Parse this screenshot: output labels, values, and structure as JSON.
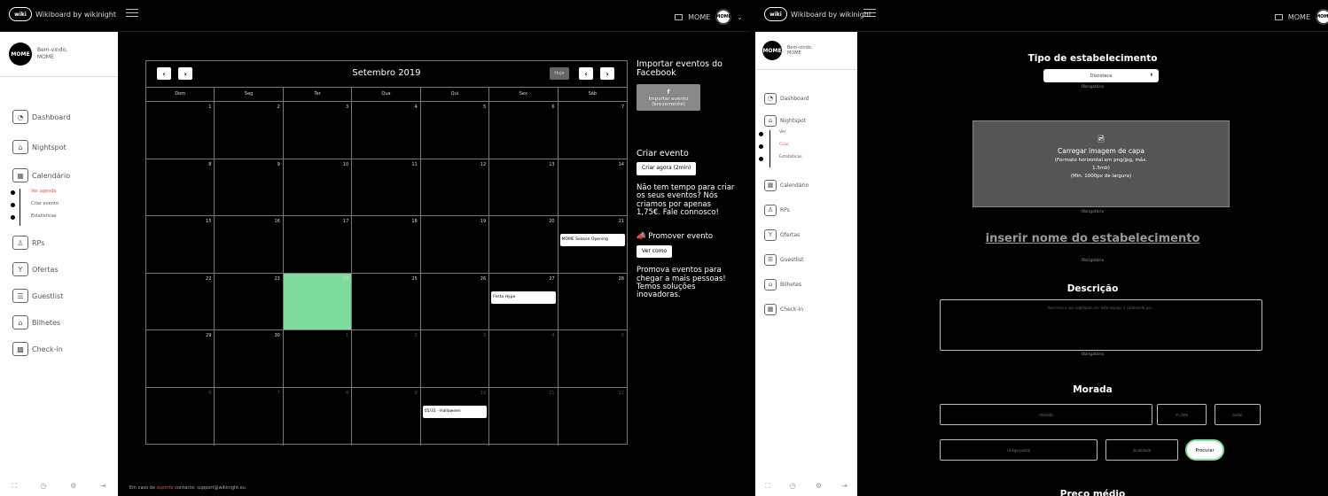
{
  "brand": {
    "logo": "wiki",
    "name": "Wikiboard by wikinight"
  },
  "user": {
    "name": "MOME",
    "greeting": "Bem-vindo,",
    "avatar_text": "MOME"
  },
  "sidebar": {
    "items": [
      {
        "label": "Dashboard",
        "icon": "dashboard-icon"
      },
      {
        "label": "Nightspot",
        "icon": "nightspot-icon"
      },
      {
        "label": "Calendário",
        "icon": "calendar-icon"
      },
      {
        "label": "RPs",
        "icon": "rps-icon"
      },
      {
        "label": "Ofertas",
        "icon": "cocktail-icon"
      },
      {
        "label": "Guestlist",
        "icon": "guestlist-icon"
      },
      {
        "label": "Bilhetes",
        "icon": "tickets-icon"
      },
      {
        "label": "Check-in",
        "icon": "qr-icon"
      }
    ],
    "calendar_sub": [
      "Ver agenda",
      "Criar evento",
      "Estatísticas"
    ],
    "nightspot_sub": [
      "Ver",
      "Criar",
      "Estatísticas"
    ]
  },
  "calendar": {
    "title": "Setembro 2019",
    "today_label": "Hoje",
    "days": [
      "Dom",
      "Seg",
      "Ter",
      "Qua",
      "Qui",
      "Sex",
      "Sáb"
    ],
    "cells": [
      "1",
      "2",
      "3",
      "4",
      "5",
      "6",
      "7",
      "8",
      "9",
      "10",
      "11",
      "12",
      "13",
      "14",
      "15",
      "16",
      "17",
      "18",
      "19",
      "20",
      "21",
      "22",
      "23",
      "24",
      "25",
      "26",
      "27",
      "28",
      "29",
      "30",
      "1",
      "2",
      "3",
      "4",
      "5",
      "6",
      "7",
      "8",
      "9",
      "10",
      "11",
      "12"
    ],
    "events": [
      {
        "cell": 20,
        "label": "MOME Season Opening"
      },
      {
        "cell": 26,
        "label": "Festa Hype"
      },
      {
        "cell": 39,
        "label": "05/31 - Halloween"
      }
    ]
  },
  "right_column": {
    "import_title": "Importar eventos do Facebook",
    "import_button": "Importar evento (brevemente)",
    "create_title": "Criar evento",
    "create_button": "Criar agora (2min)",
    "pitch_text": "Não tem tempo para criar os seus eventos? Nós criamos por apenas 1,75€. Fale connosco!",
    "promote_title": "Promover evento",
    "promote_button": "Ver como",
    "promote_text": "Promova eventos para chegar a mais pessoas! Temos soluções inovadoras."
  },
  "footer": {
    "prefix": "Em caso de",
    "link": "suporte",
    "suffix": "contacte: support@wikinight.eu"
  },
  "form": {
    "type_title": "Tipo de estabelecimento",
    "type_value": "Discoteca",
    "required": "Obrigatório",
    "upload_title": "Carregar imagem de capa",
    "upload_line1": "(Formato horizontal em png/jpg, máx.",
    "upload_line2": "1.5mb)",
    "upload_line3": "(Min. 1000px de largura)",
    "name_placeholder": "inserir nome do estabelecimento",
    "description_title": "Descrição",
    "description_placeholder": "descreva o seu nightspot, ex: este espaço é conhecido por...",
    "address_title": "Morada",
    "address_placeholder": "morada",
    "number_placeholder": "nº./lote",
    "floor_placeholder": "andar",
    "postal_placeholder": "código postal",
    "city_placeholder": "localidade",
    "search_button": "Procurar",
    "price_title": "Preço médio"
  },
  "colors": {
    "today": "#7ddc9e",
    "accent_red": "#e05050"
  }
}
